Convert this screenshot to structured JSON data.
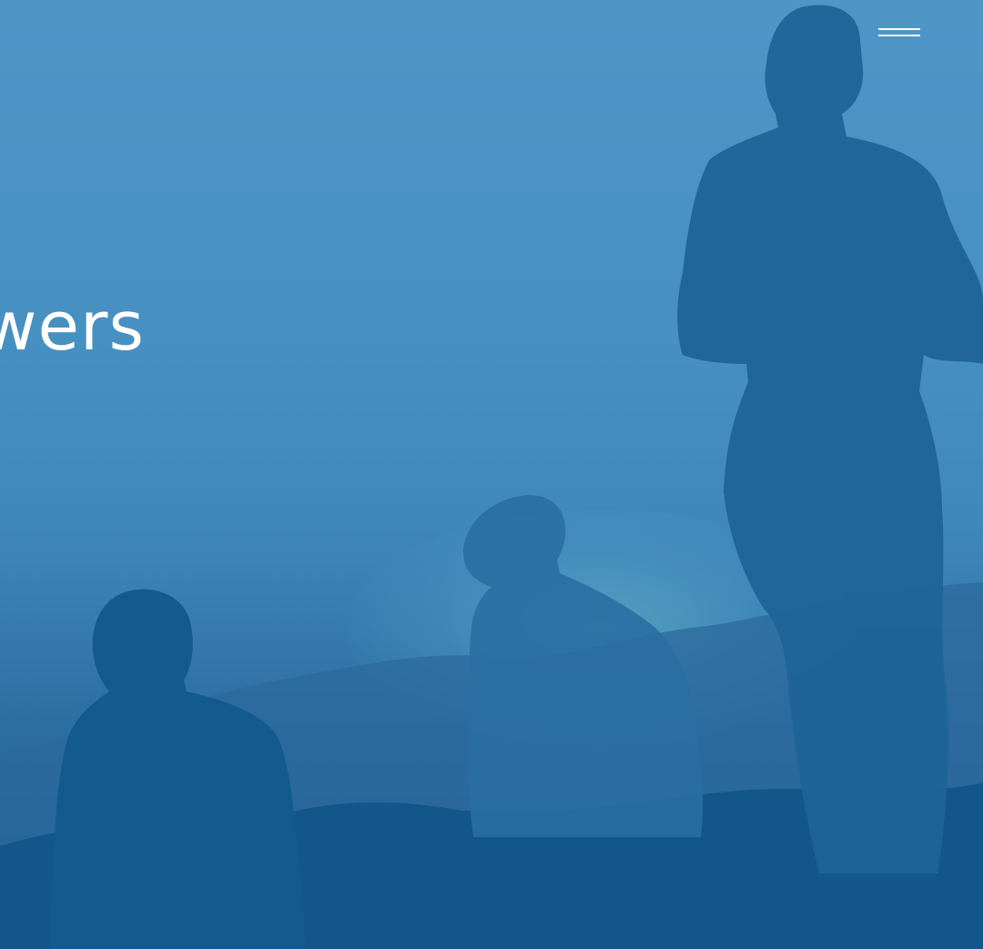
{
  "hero": {
    "title": "wers",
    "overlay_color": "#2f78b0"
  },
  "header": {
    "menu_icon": "hamburger-menu-icon"
  }
}
